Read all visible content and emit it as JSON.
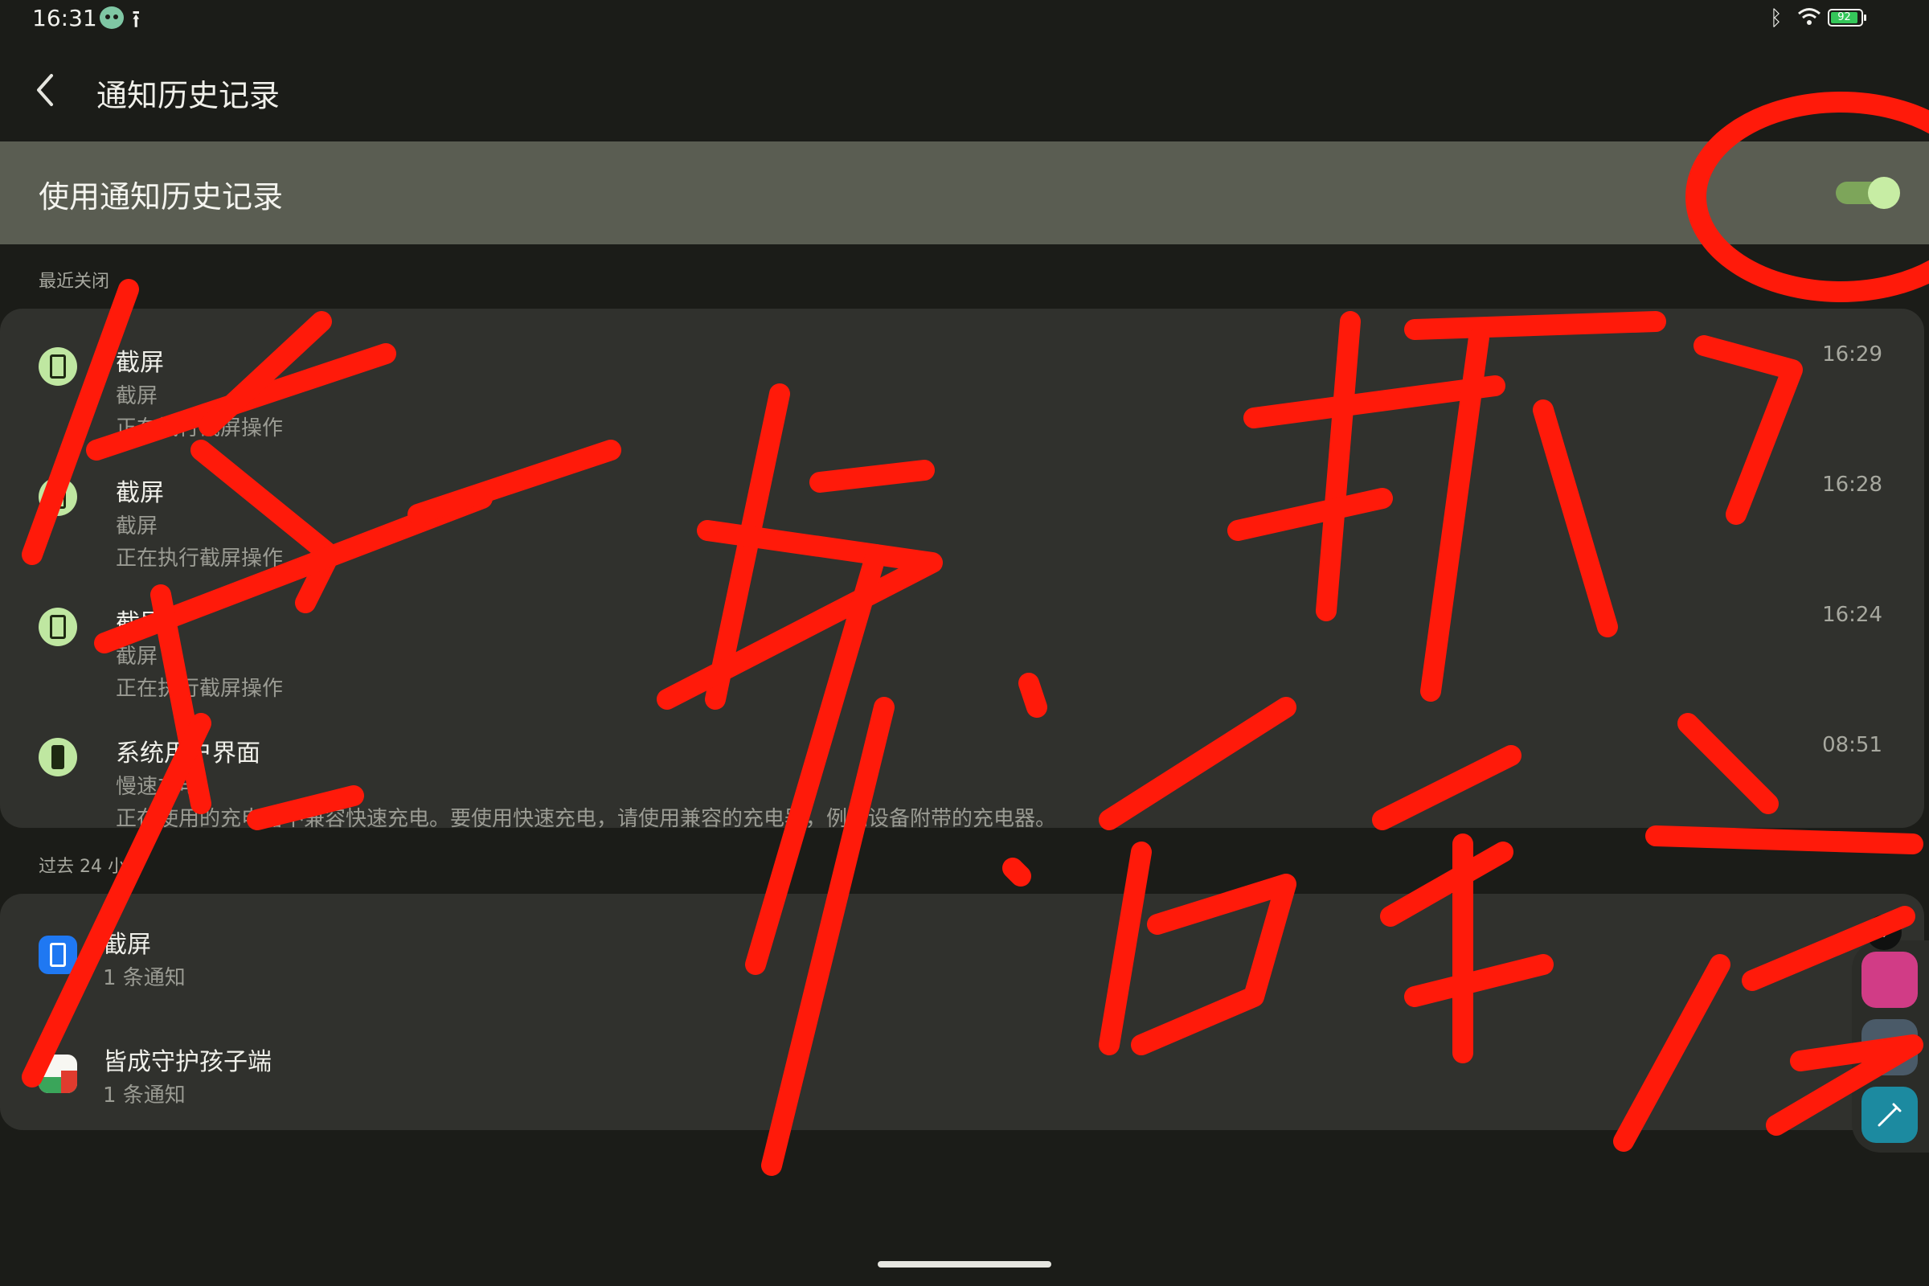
{
  "status_bar": {
    "time": "16:31",
    "upload_glyph": "⭱",
    "battery_level": "92",
    "icons": [
      "app-notification-icon",
      "upload-icon",
      "bluetooth-icon",
      "wifi-icon",
      "battery-icon"
    ]
  },
  "header": {
    "title": "通知历史记录",
    "back_icon": "chevron-left-icon"
  },
  "master_switch": {
    "label": "使用通知历史记录",
    "enabled": true,
    "colors": {
      "track": "#7da55a",
      "thumb": "#c7eda4",
      "row_bg": "#5a5d52"
    }
  },
  "recent": {
    "header": "最近关闭",
    "items": [
      {
        "title": "截屏",
        "line1": "截屏",
        "line2": "正在执行截屏操作",
        "time": "16:29",
        "icon": "screenshot-icon"
      },
      {
        "title": "截屏",
        "line1": "截屏",
        "line2": "正在执行截屏操作",
        "time": "16:28",
        "icon": "screenshot-icon"
      },
      {
        "title": "截屏",
        "line1": "截屏",
        "line2": "正在执行截屏操作",
        "time": "16:24",
        "icon": "screenshot-icon"
      },
      {
        "title": "系统用户界面",
        "line1": "慢速充电",
        "line2": "正在使用的充电器不兼容快速充电。要使用快速充电，请使用兼容的充电器，例如设备附带的充电器。",
        "time": "08:51",
        "icon": "battery-icon"
      }
    ]
  },
  "past24": {
    "header": "过去 24 小时",
    "items": [
      {
        "title": "截屏",
        "sub": "1 条通知",
        "icon": "screenshot-app-icon"
      },
      {
        "title": "皆成守护孩子端",
        "sub": "1 条通知",
        "icon": "app-icon"
      }
    ]
  },
  "floating_tools": {
    "icons": [
      "collapse-icon",
      "record-icon",
      "capture-icon",
      "pen-icon"
    ]
  },
  "annotation": {
    "text": "第一步：打开。第二步：后重启",
    "color": "#ff1a0a"
  }
}
